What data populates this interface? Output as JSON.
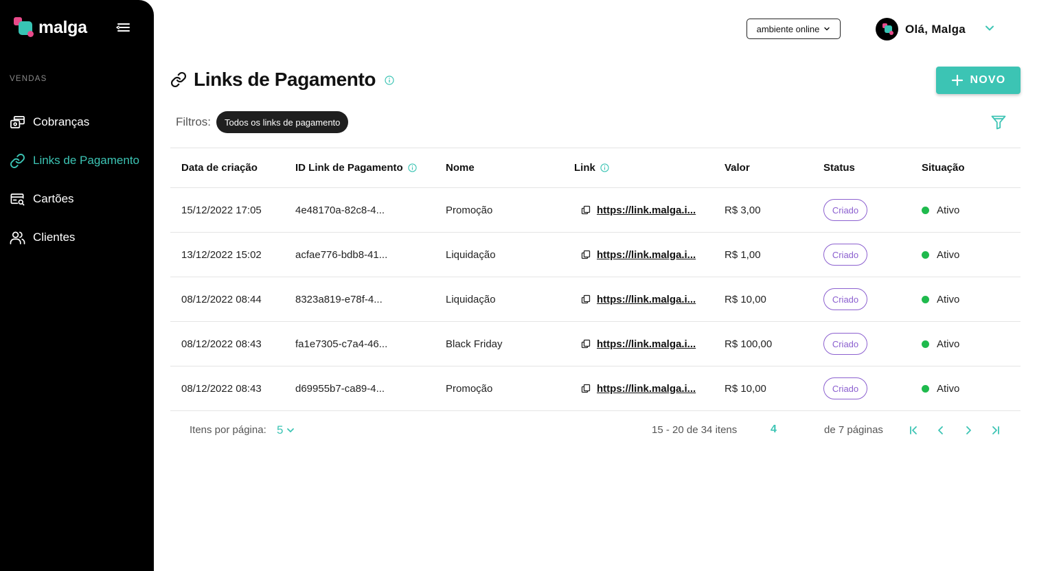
{
  "brand": {
    "name": "malga"
  },
  "sidebar": {
    "section": "VENDAS",
    "items": [
      {
        "label": "Cobranças",
        "icon": "charges-icon"
      },
      {
        "label": "Links de Pagamento",
        "icon": "link-icon",
        "active": true
      },
      {
        "label": "Cartões",
        "icon": "card-search-icon"
      },
      {
        "label": "Clientes",
        "icon": "users-icon"
      }
    ]
  },
  "header": {
    "environment": "ambiente online",
    "greeting": "Olá, Malga"
  },
  "page": {
    "title": "Links de Pagamento",
    "new_button": "NOVO",
    "filters_label": "Filtros:",
    "filter_chip": "Todos os links de pagamento"
  },
  "table": {
    "columns": [
      "Data de criação",
      "ID Link de Pagamento",
      "Nome",
      "Link",
      "Valor",
      "Status",
      "Situação"
    ],
    "rows": [
      {
        "date": "15/12/2022 17:05",
        "id": "4e48170a-82c8-4...",
        "name": "Promoção",
        "link": "https://link.malga.i...",
        "value": "R$ 3,00",
        "status": "Criado",
        "situation": "Ativo"
      },
      {
        "date": "13/12/2022 15:02",
        "id": "acfae776-bdb8-41...",
        "name": "Liquidação",
        "link": "https://link.malga.i...",
        "value": "R$ 1,00",
        "status": "Criado",
        "situation": "Ativo"
      },
      {
        "date": "08/12/2022 08:44",
        "id": "8323a819-e78f-4...",
        "name": "Liquidação",
        "link": "https://link.malga.i...",
        "value": "R$ 10,00",
        "status": "Criado",
        "situation": "Ativo"
      },
      {
        "date": "08/12/2022 08:43",
        "id": "fa1e7305-c7a4-46...",
        "name": "Black Friday",
        "link": "https://link.malga.i...",
        "value": "R$ 100,00",
        "status": "Criado",
        "situation": "Ativo"
      },
      {
        "date": "08/12/2022 08:43",
        "id": "d69955b7-ca89-4...",
        "name": "Promoção",
        "link": "https://link.malga.i...",
        "value": "R$ 10,00",
        "status": "Criado",
        "situation": "Ativo"
      }
    ]
  },
  "pagination": {
    "per_page_label": "Itens por página:",
    "per_page": "5",
    "range": "15 - 20 de 34 itens",
    "current_page": "4",
    "total_pages": "de 7 páginas"
  },
  "colors": {
    "accent": "#3cc4b4",
    "brand_pink": "#e84a8a",
    "status_border": "#8b5fcf",
    "active_dot": "#1fba4d",
    "sidebar_bg": "#000000"
  }
}
